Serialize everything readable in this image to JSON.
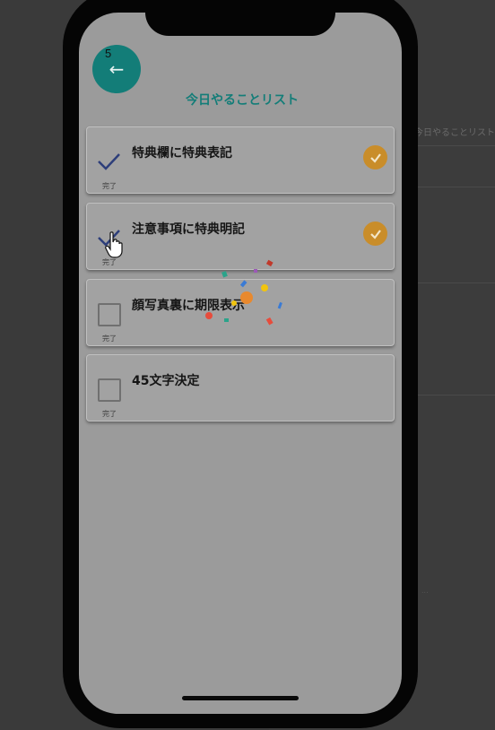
{
  "background_page": {
    "heading": "今日やることリスト",
    "faint_text": "..."
  },
  "app": {
    "back_badge": "5",
    "back_icon": "←",
    "title": "今日やることリスト",
    "accent_color": "#137d78",
    "done_color": "#c98d2a"
  },
  "tasks": [
    {
      "label": "特典欄に特典表記",
      "done_label": "完了",
      "completed": true
    },
    {
      "label": "注意事項に特典明記",
      "done_label": "完了",
      "completed": true
    },
    {
      "label": "顔写真裏に期限表示",
      "done_label": "完了",
      "completed": false
    },
    {
      "label": "45文字決定",
      "done_label": "完了",
      "completed": false
    }
  ]
}
